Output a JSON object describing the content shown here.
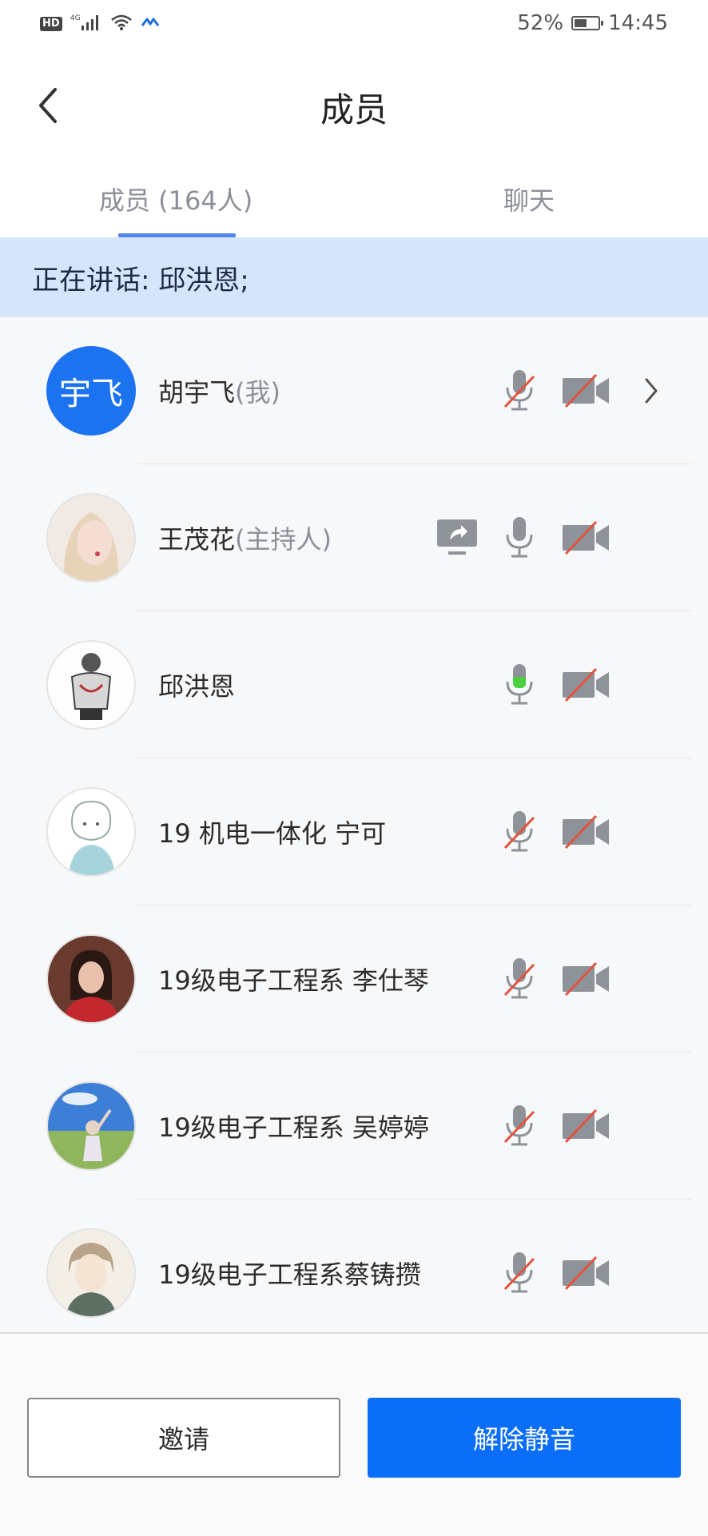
{
  "status_bar": {
    "hd": "HD",
    "network": "4G",
    "battery": "52%",
    "battery_level": 0.52,
    "time": "14:45"
  },
  "header": {
    "title": "成员",
    "back_icon": "chevron-left-icon"
  },
  "tabs": [
    {
      "label": "成员 (164人)",
      "active": true
    },
    {
      "label": "聊天",
      "active": false
    }
  ],
  "speaking_banner": "正在讲话: 邱洪恩;",
  "members": [
    {
      "name": "胡宇飞",
      "role": "(我)",
      "avatar_text": "宇飞",
      "mic": "muted",
      "camera": "off",
      "sharing": false,
      "has_detail": true
    },
    {
      "name": "王茂花",
      "role": "(主持人)",
      "avatar_text": "",
      "mic": "on",
      "camera": "off",
      "sharing": true,
      "has_detail": false
    },
    {
      "name": "邱洪恩",
      "role": "",
      "avatar_text": "",
      "mic": "speaking",
      "camera": "off",
      "sharing": false,
      "has_detail": false
    },
    {
      "name": "19 机电一体化 宁可",
      "role": "",
      "avatar_text": "",
      "mic": "muted",
      "camera": "off",
      "sharing": false,
      "has_detail": false
    },
    {
      "name": "19级电子工程系  李仕琴",
      "role": "",
      "avatar_text": "",
      "mic": "muted",
      "camera": "off",
      "sharing": false,
      "has_detail": false
    },
    {
      "name": "19级电子工程系 吴婷婷",
      "role": "",
      "avatar_text": "",
      "mic": "muted",
      "camera": "off",
      "sharing": false,
      "has_detail": false
    },
    {
      "name": "19级电子工程系蔡铸攒",
      "role": "",
      "avatar_text": "",
      "mic": "muted",
      "camera": "off",
      "sharing": false,
      "has_detail": false
    }
  ],
  "buttons": {
    "invite": "邀请",
    "unmute": "解除静音"
  },
  "colors": {
    "accent": "#0a6ef9",
    "banner": "#d5e6fb",
    "muted_slash": "#e0533d",
    "speaking": "#4cd040"
  }
}
